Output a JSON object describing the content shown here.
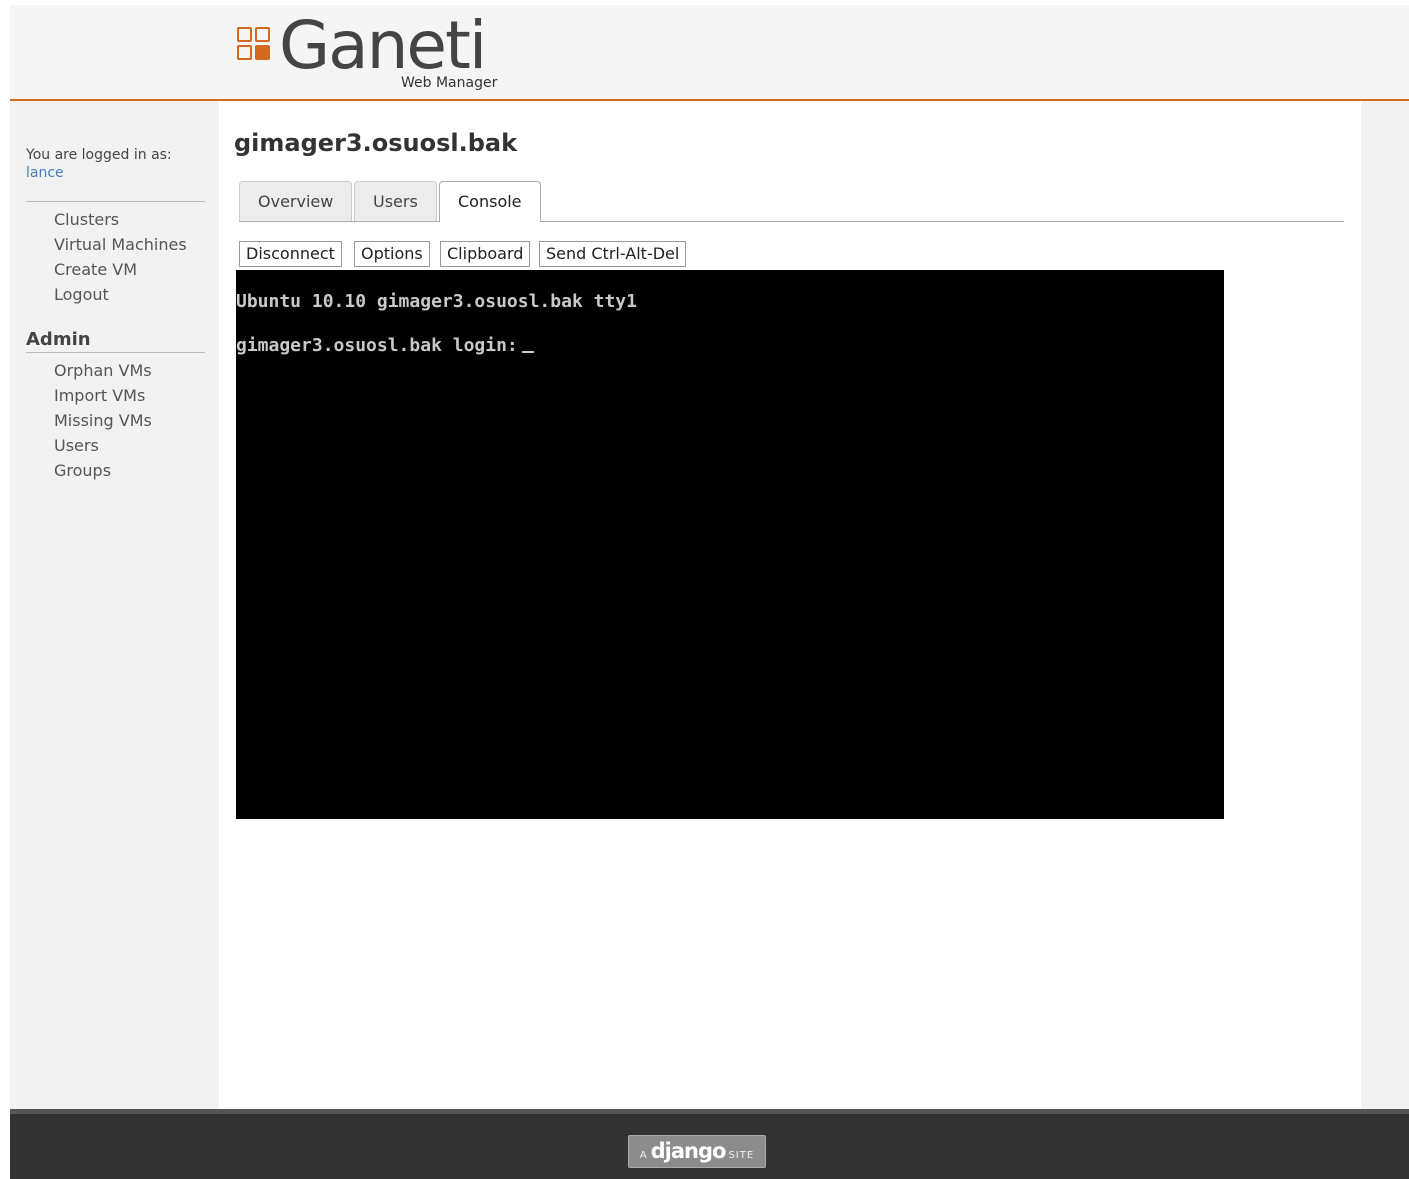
{
  "brand": {
    "name": "Ganeti",
    "subtitle": "Web Manager",
    "accent_color": "#d2691e"
  },
  "sidebar": {
    "logged_in_label": "You are logged in as:",
    "username": "lance",
    "nav": [
      {
        "label": "Clusters"
      },
      {
        "label": "Virtual Machines"
      },
      {
        "label": "Create VM"
      },
      {
        "label": "Logout"
      }
    ],
    "admin_heading": "Admin",
    "admin_nav": [
      {
        "label": "Orphan VMs"
      },
      {
        "label": "Import VMs"
      },
      {
        "label": "Missing VMs"
      },
      {
        "label": "Users"
      },
      {
        "label": "Groups"
      }
    ]
  },
  "main": {
    "title": "gimager3.osuosl.bak",
    "tabs": [
      {
        "label": "Overview",
        "active": false
      },
      {
        "label": "Users",
        "active": false
      },
      {
        "label": "Console",
        "active": true
      }
    ],
    "vnc_buttons": [
      {
        "label": "Disconnect"
      },
      {
        "label": "Options"
      },
      {
        "label": "Clipboard"
      },
      {
        "label": "Send Ctrl-Alt-Del"
      }
    ],
    "console": {
      "line1": "Ubuntu 10.10 gimager3.osuosl.bak tty1",
      "line2": "gimager3.osuosl.bak login:"
    }
  },
  "footer": {
    "badge_prefix": "A",
    "badge_main": "django",
    "badge_suffix": "SITE"
  }
}
